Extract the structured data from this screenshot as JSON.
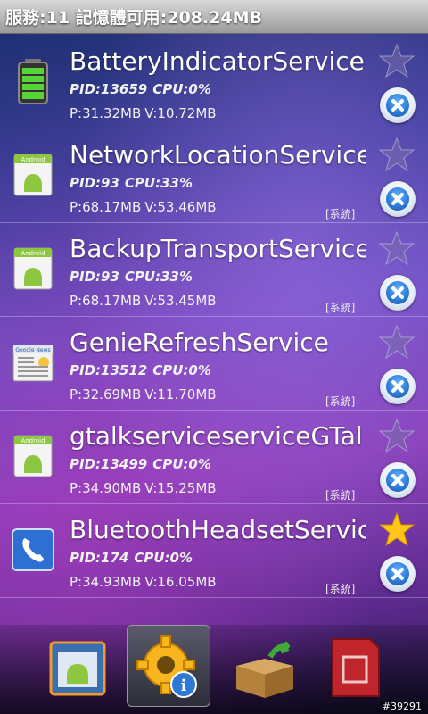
{
  "status_bar": {
    "text": "服務:11 記憶體可用:208.24MB"
  },
  "services": [
    {
      "name": "BatteryIndicatorService",
      "pid": "PID:13659",
      "cpu": "CPU:0%",
      "p_mem": "P:31.32MB",
      "v_mem": "V:10.72MB",
      "system_tag": "",
      "icon": "battery-icon",
      "favorite": false
    },
    {
      "name": "NetworkLocationService",
      "pid": "PID:93",
      "cpu": "CPU:33%",
      "p_mem": "P:68.17MB",
      "v_mem": "V:53.46MB",
      "system_tag": "[系統]",
      "icon": "android-app-icon",
      "favorite": false
    },
    {
      "name": "BackupTransportService",
      "pid": "PID:93",
      "cpu": "CPU:33%",
      "p_mem": "P:68.17MB",
      "v_mem": "V:53.45MB",
      "system_tag": "[系統]",
      "icon": "android-app-icon",
      "favorite": false
    },
    {
      "name": "GenieRefreshService",
      "pid": "PID:13512",
      "cpu": "CPU:0%",
      "p_mem": "P:32.69MB",
      "v_mem": "V:11.70MB",
      "system_tag": "[系統]",
      "icon": "google-news-icon",
      "favorite": false
    },
    {
      "name": "gtalkserviceserviceGTal",
      "pid": "PID:13499",
      "cpu": "CPU:0%",
      "p_mem": "P:34.90MB",
      "v_mem": "V:15.25MB",
      "system_tag": "[系統]",
      "icon": "android-app-icon",
      "favorite": false
    },
    {
      "name": "BluetoothHeadsetService",
      "pid": "PID:174",
      "cpu": "CPU:0%",
      "p_mem": "P:34.93MB",
      "v_mem": "V:16.05MB",
      "system_tag": "[系統]",
      "icon": "phone-icon",
      "favorite": true
    }
  ],
  "bottom_tabs": [
    {
      "icon": "app-manager-icon",
      "selected": false
    },
    {
      "icon": "settings-info-icon",
      "selected": true
    },
    {
      "icon": "box-install-icon",
      "selected": false
    },
    {
      "icon": "sd-card-icon",
      "selected": false
    }
  ],
  "watermark": "#39291",
  "colors": {
    "kill_button": "#2c79d6",
    "favorite_star": "#ffc61a",
    "status_bar": "#b5b5b5"
  }
}
